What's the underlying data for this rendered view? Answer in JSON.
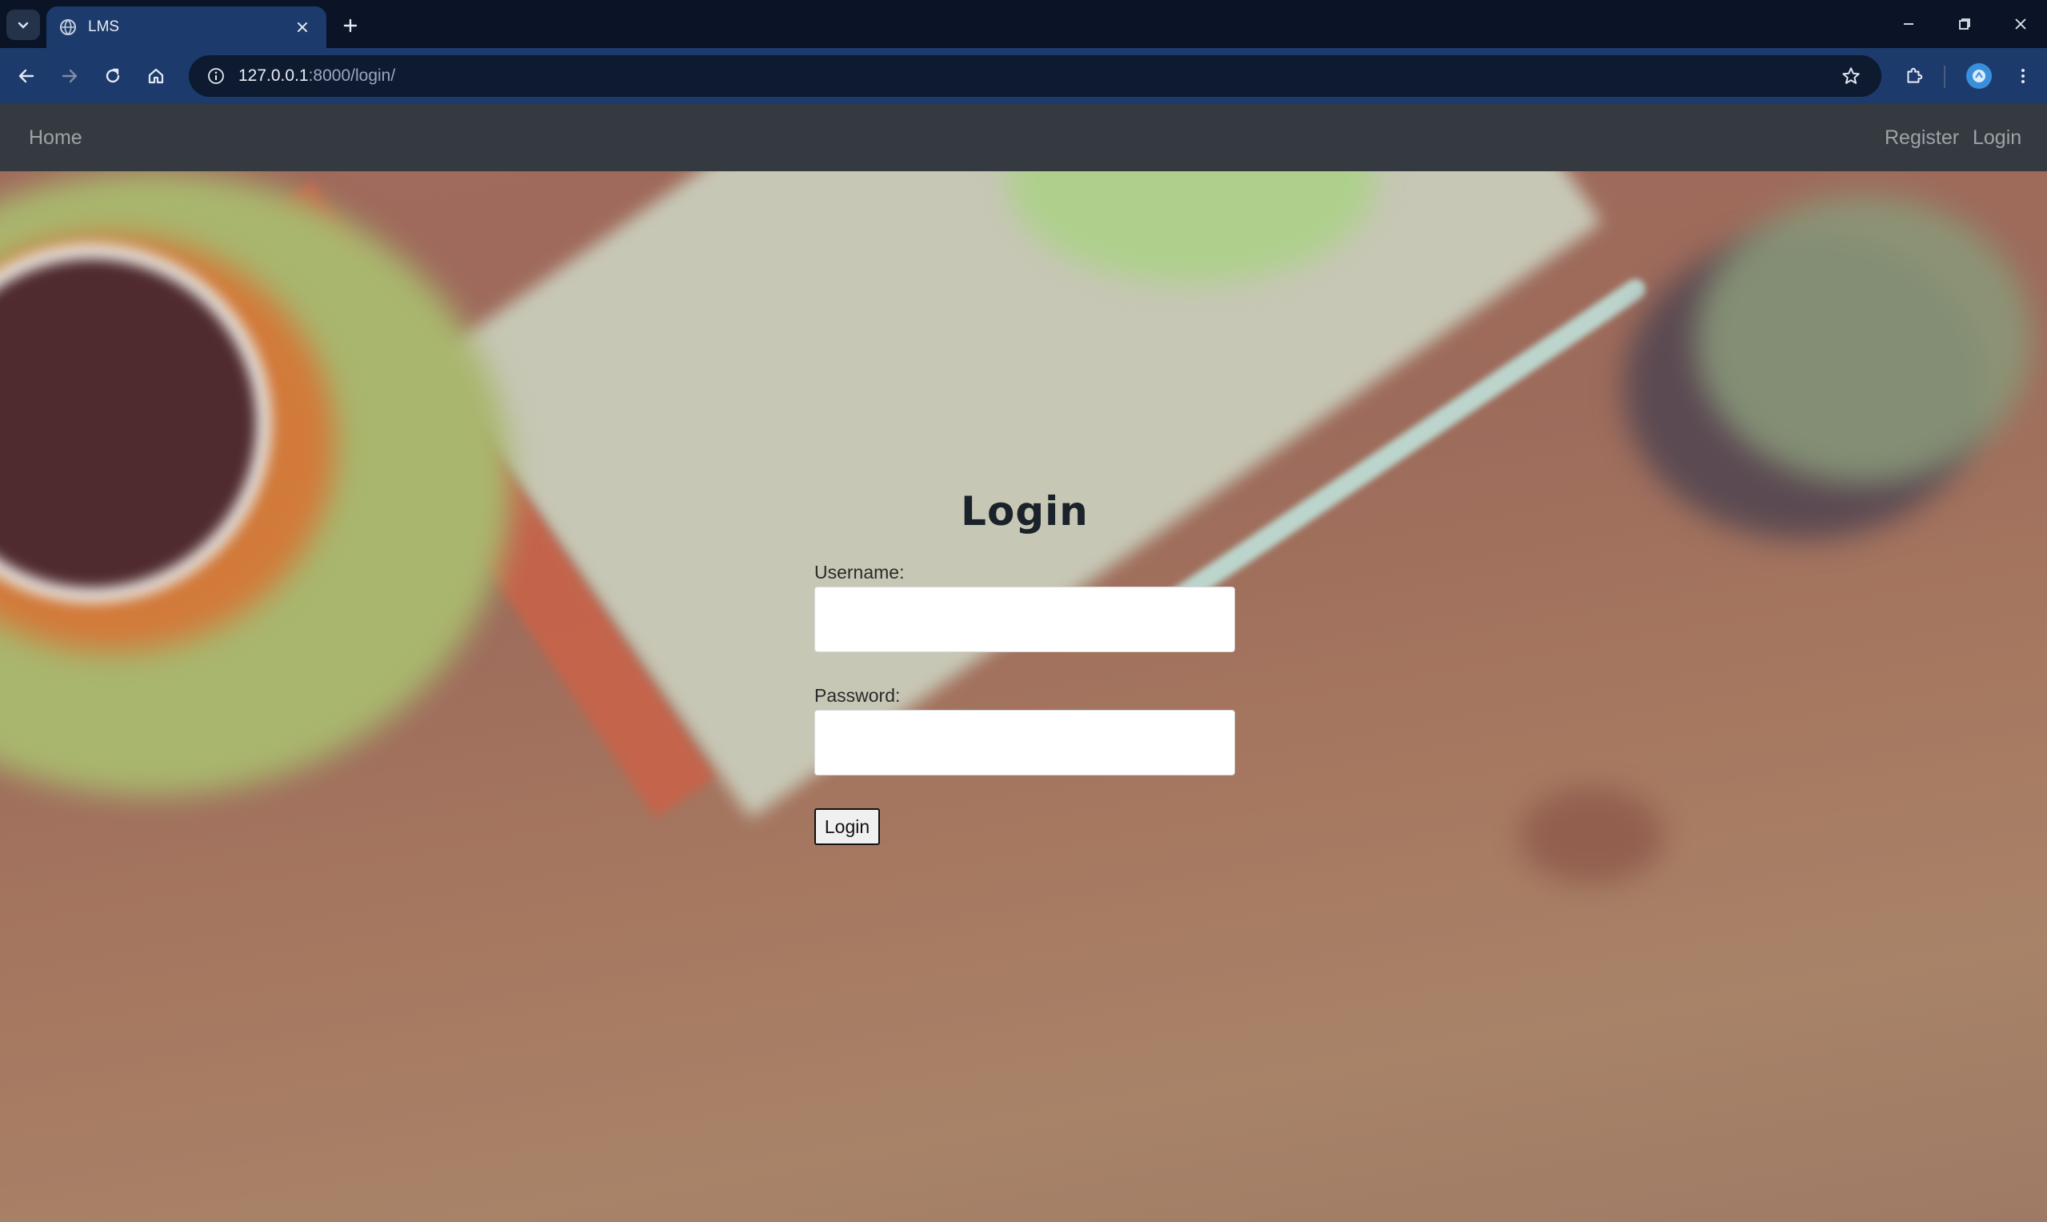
{
  "browser": {
    "tab_title": "LMS",
    "url_host": "127.0.0.1",
    "url_rest": ":8000/login/"
  },
  "navbar": {
    "home": "Home",
    "register": "Register",
    "login": "Login"
  },
  "login_form": {
    "title": "Login",
    "username_label": "Username:",
    "username_value": "",
    "password_label": "Password:",
    "password_value": "",
    "submit_label": "Login"
  }
}
